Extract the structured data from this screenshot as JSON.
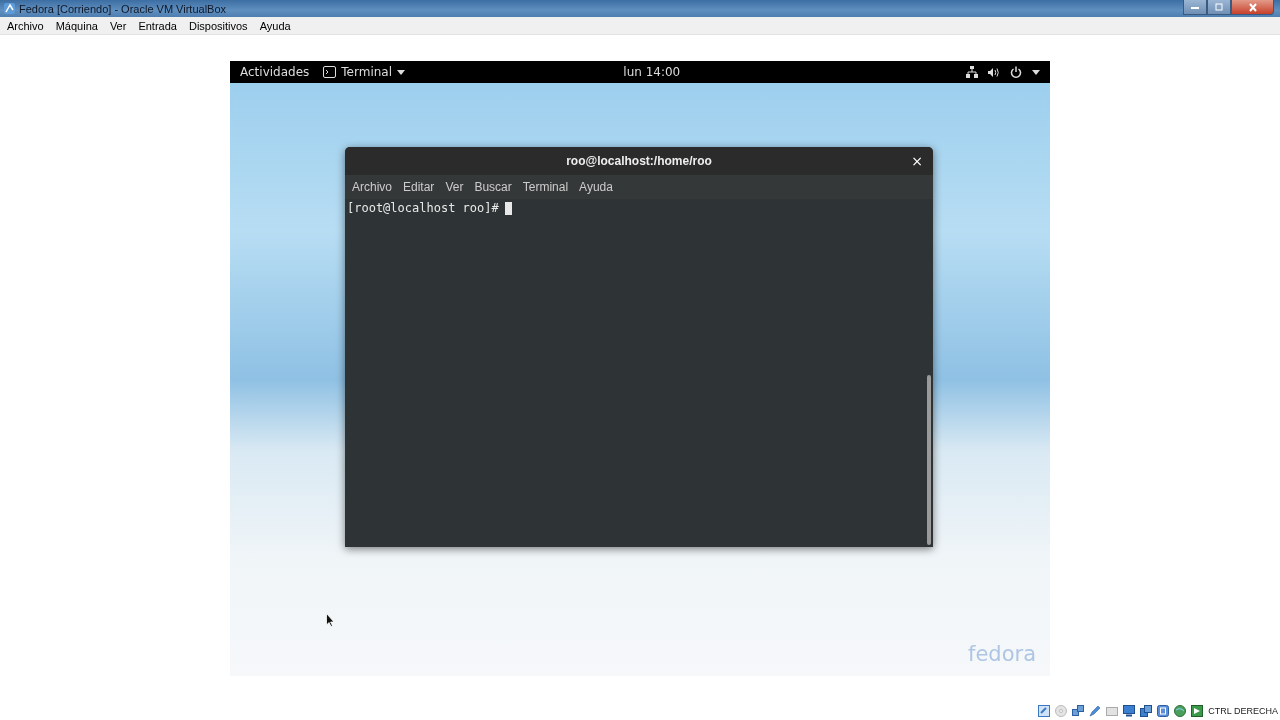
{
  "window": {
    "title": "Fedora [Corriendo] - Oracle VM VirtualBox"
  },
  "menu": [
    "Archivo",
    "Máquina",
    "Ver",
    "Entrada",
    "Dispositivos",
    "Ayuda"
  ],
  "guest": {
    "top_bar": {
      "activities": "Actividades",
      "app_menu": "Terminal",
      "clock": "lun 14:00"
    },
    "terminal": {
      "title": "roo@localhost:/home/roo",
      "close": "×",
      "menu": [
        "Archivo",
        "Editar",
        "Ver",
        "Buscar",
        "Terminal",
        "Ayuda"
      ],
      "prompt": "[root@localhost roo]#"
    },
    "logo": "fedora"
  },
  "status_bar": {
    "host_key": "CTRL DERECHA"
  }
}
